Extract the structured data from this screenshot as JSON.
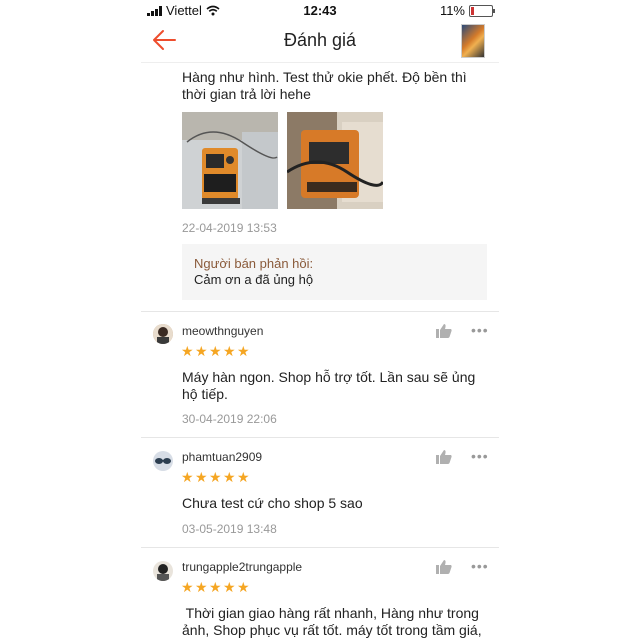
{
  "status_bar": {
    "carrier": "Viettel",
    "time": "12:43",
    "battery": "11%"
  },
  "header": {
    "title": "Đánh giá"
  },
  "first_review": {
    "text_line1": "Hàng như hình. Test thử okie phết. Độ bền thì",
    "text_line2": "thời gian trả lời hehe",
    "date": "22-04-2019 13:53",
    "seller_reply_label": "Người bán phản hồi:",
    "seller_reply_text": "Cảm ơn a đã ủng hộ"
  },
  "reviews": [
    {
      "username": "meowthnguyen",
      "rating": 5,
      "text_line1": "Máy hàn ngon. Shop hỗ trợ tốt. Lần sau sẽ ủng",
      "text_line2": "hộ tiếp.",
      "date": "30-04-2019 22:06"
    },
    {
      "username": "phamtuan2909",
      "rating": 5,
      "text_line1": "Chưa test cứ cho shop 5 sao",
      "date": "03-05-2019 13:48"
    },
    {
      "username": "trungapple2trungapple",
      "rating": 5,
      "text_line1": " Thời gian giao hàng rất nhanh, Hàng như trong",
      "text_line2": "ảnh, Shop phục vụ rất tốt. máy tốt trong tầm giá,"
    }
  ],
  "icons": {
    "back": "back-arrow-icon",
    "like": "thumbs-up-icon",
    "more": "more-dots-icon",
    "star": "star-icon"
  },
  "colors": {
    "accent": "#ee4d2d",
    "star": "#f5a623",
    "reply_label": "#8a5a3a"
  }
}
